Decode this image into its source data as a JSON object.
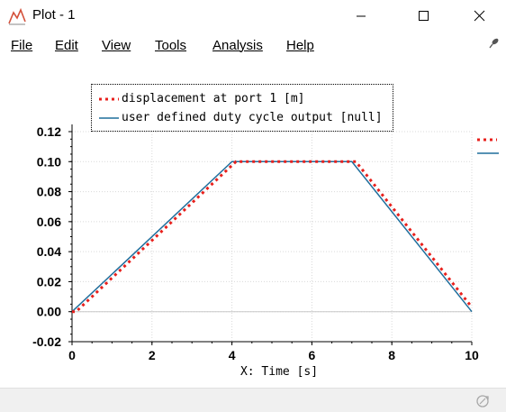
{
  "window": {
    "title": "Plot - 1",
    "icons": [
      "app-chart-icon",
      "minimize-icon",
      "maximize-icon",
      "close-icon"
    ]
  },
  "menu": {
    "items": [
      {
        "label": "File"
      },
      {
        "label": "Edit"
      },
      {
        "label": "View"
      },
      {
        "label": "Tools"
      },
      {
        "label": "Analysis"
      },
      {
        "label": "Help"
      }
    ]
  },
  "toolbar": {
    "buttons": [
      "select-arrow-icon",
      "zoom-region-icon",
      "zoom-out-icon",
      "zoom-reset-icon",
      "vertical-cursor-icon",
      "crosshair-cursor-icon",
      "dual-cursor-icon",
      "cursor-track-icon",
      "table-view-icon",
      "grid-layout-icon",
      "refresh-icon",
      "pin-curve-icon",
      "waveform-icon",
      "histogram-icon",
      "xy-plot-icon",
      "add-plot-icon"
    ]
  },
  "legend": {
    "entries": [
      {
        "label": "displacement at port 1 [m]",
        "color": "#e8201c",
        "style": "dotted"
      },
      {
        "label": "user defined duty cycle output [null]",
        "color": "#1f6e9c",
        "style": "solid"
      }
    ]
  },
  "chart_data": {
    "type": "line",
    "xlabel": "X: Time [s]",
    "ylabel": "",
    "xlim": [
      0,
      10
    ],
    "ylim": [
      -0.02,
      0.12
    ],
    "xticks": [
      "0",
      "2",
      "4",
      "6",
      "8",
      "10"
    ],
    "yticks": [
      "-0.02",
      "0.00",
      "0.02",
      "0.04",
      "0.06",
      "0.08",
      "0.10",
      "0.12"
    ],
    "grid": true,
    "legend_position": "top",
    "series": [
      {
        "name": "displacement at port 1 [m]",
        "color": "#e8201c",
        "style": "dotted",
        "x": [
          0,
          0.1,
          4.1,
          7.1,
          10.0
        ],
        "y": [
          0.0,
          0.0,
          0.1,
          0.1,
          0.003
        ]
      },
      {
        "name": "user defined duty cycle output [null]",
        "color": "#1f6e9c",
        "style": "solid",
        "x": [
          0,
          4,
          7,
          10
        ],
        "y": [
          0.0,
          0.1,
          0.1,
          0.0
        ]
      }
    ]
  }
}
